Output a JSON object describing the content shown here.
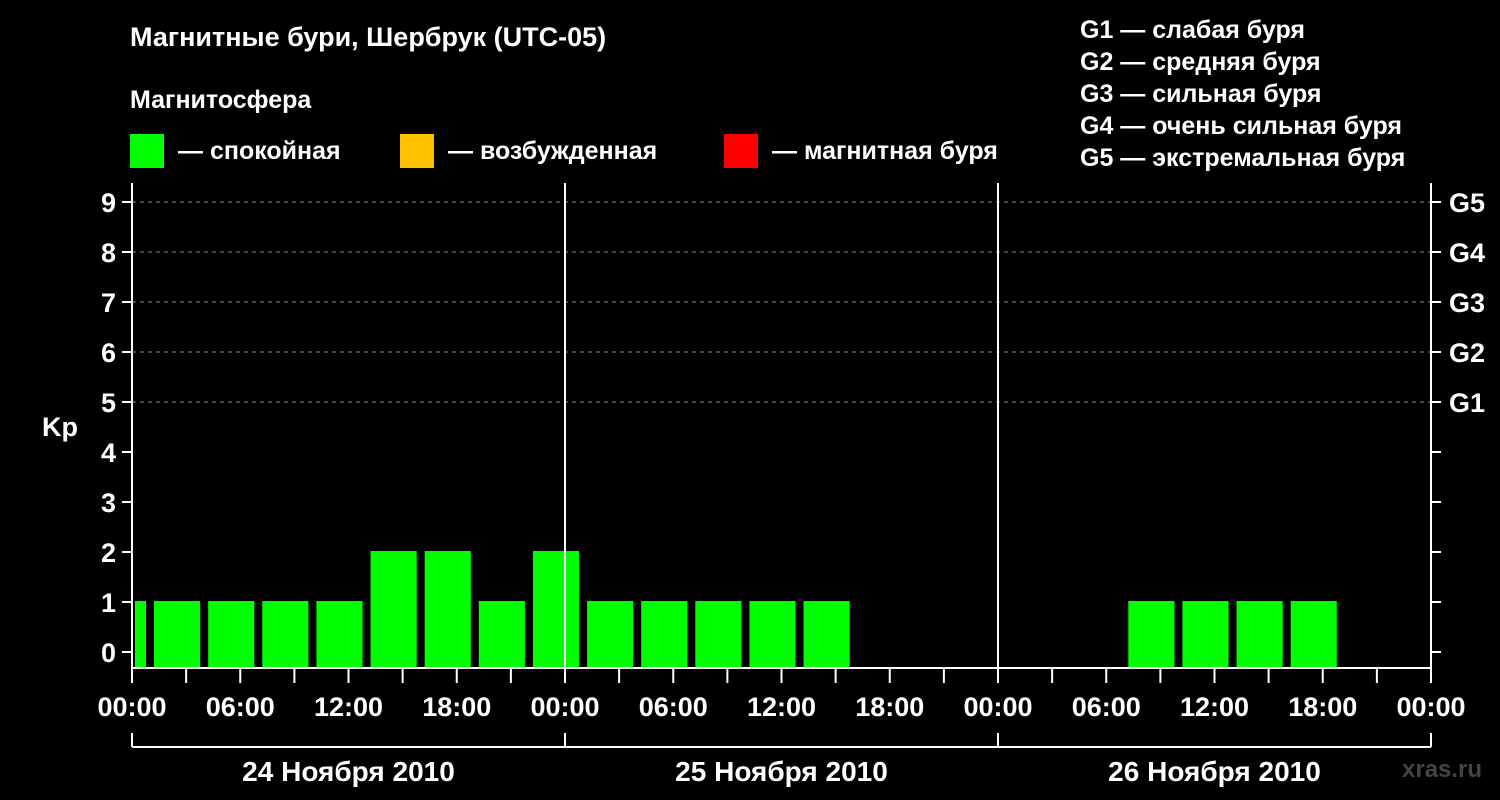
{
  "header": {
    "title": "Магнитные бури, Шербрук (UTC-05)",
    "subtitle": "Магнитосфера"
  },
  "legend": [
    {
      "label": "— спокойная",
      "color": "#00ff00"
    },
    {
      "label": "— возбужденная",
      "color": "#ffc000"
    },
    {
      "label": "— магнитная буря",
      "color": "#ff0000"
    }
  ],
  "g_scale": [
    "G1 — слабая буря",
    "G2 — средняя буря",
    "G3 — сильная буря",
    "G4 — очень сильная буря",
    "G5 — экстремальная буря"
  ],
  "watermark": "xras.ru",
  "chart_data": {
    "type": "bar",
    "ylabel": "Kp",
    "ylim": [
      0,
      9
    ],
    "yticks": [
      "0",
      "1",
      "2",
      "3",
      "4",
      "5",
      "6",
      "7",
      "8",
      "9"
    ],
    "right_ticks": [
      {
        "kp": 5,
        "label": "G1"
      },
      {
        "kp": 6,
        "label": "G2"
      },
      {
        "kp": 7,
        "label": "G3"
      },
      {
        "kp": 8,
        "label": "G4"
      },
      {
        "kp": 9,
        "label": "G5"
      }
    ],
    "xtick_labels": [
      "00:00",
      "06:00",
      "12:00",
      "18:00",
      "00:00",
      "06:00",
      "12:00",
      "18:00",
      "00:00",
      "06:00",
      "12:00",
      "18:00",
      "00:00"
    ],
    "days": [
      "24 Ноября 2010",
      "25 Ноября 2010",
      "26 Ноября 2010"
    ],
    "grid": "dashed at Kp 5-9",
    "bars": [
      {
        "start_hour": 0,
        "end_hour": 1,
        "kp": 1
      },
      {
        "start_hour": 1,
        "end_hour": 4,
        "kp": 1
      },
      {
        "start_hour": 4,
        "end_hour": 7,
        "kp": 1
      },
      {
        "start_hour": 7,
        "end_hour": 10,
        "kp": 1
      },
      {
        "start_hour": 10,
        "end_hour": 13,
        "kp": 1
      },
      {
        "start_hour": 13,
        "end_hour": 16,
        "kp": 2
      },
      {
        "start_hour": 16,
        "end_hour": 19,
        "kp": 2
      },
      {
        "start_hour": 19,
        "end_hour": 22,
        "kp": 1
      },
      {
        "start_hour": 22,
        "end_hour": 25,
        "kp": 2
      },
      {
        "start_hour": 25,
        "end_hour": 28,
        "kp": 1
      },
      {
        "start_hour": 28,
        "end_hour": 31,
        "kp": 1
      },
      {
        "start_hour": 31,
        "end_hour": 34,
        "kp": 1
      },
      {
        "start_hour": 34,
        "end_hour": 37,
        "kp": 1
      },
      {
        "start_hour": 37,
        "end_hour": 40,
        "kp": 1
      },
      {
        "start_hour": 55,
        "end_hour": 58,
        "kp": 1
      },
      {
        "start_hour": 58,
        "end_hour": 61,
        "kp": 1
      },
      {
        "start_hour": 61,
        "end_hour": 64,
        "kp": 1
      },
      {
        "start_hour": 64,
        "end_hour": 67,
        "kp": 1
      }
    ]
  }
}
